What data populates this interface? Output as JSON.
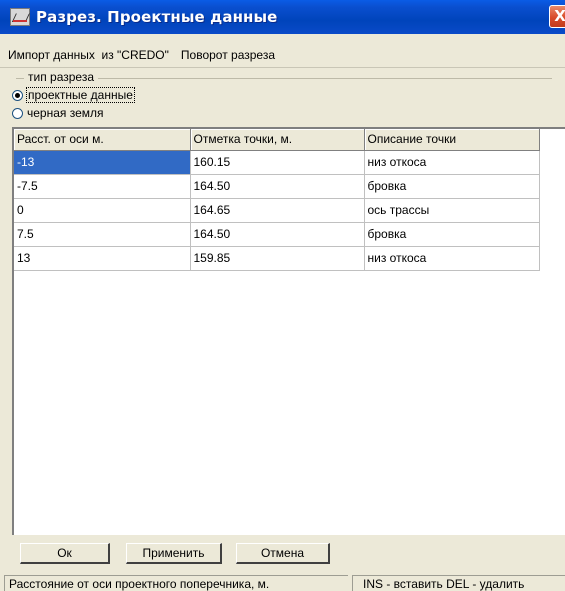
{
  "window": {
    "title": "Разрез. Проектные данные",
    "close_label": "X"
  },
  "menu": {
    "items": [
      {
        "label": "Импорт данных  из \"CREDO\""
      },
      {
        "label": "Поворот разреза"
      }
    ]
  },
  "section_type": {
    "legend": "тип разреза",
    "options": [
      {
        "label": "проектные данные",
        "checked": true
      },
      {
        "label": "черная земля",
        "checked": false
      }
    ]
  },
  "table": {
    "columns": [
      "Расст. от оси  м.",
      "Отметка точки, м.",
      "Описание точки"
    ],
    "rows": [
      [
        "-13",
        "160.15",
        "низ откоса"
      ],
      [
        "-7.5",
        "164.50",
        "бровка"
      ],
      [
        "0",
        "164.65",
        "ось трассы"
      ],
      [
        "7.5",
        "164.50",
        "бровка"
      ],
      [
        "13",
        "159.85",
        "низ откоса"
      ]
    ],
    "selected_cell": {
      "row": 0,
      "col": 0
    }
  },
  "buttons": {
    "ok": "Ок",
    "apply": "Применить",
    "cancel": "Отмена"
  },
  "status": {
    "left": "Расстояние от оси проектного поперечника, м.",
    "right": "INS - вставить DEL - удалить"
  },
  "colors": {
    "selection": "#316ac5",
    "titlebar": "#0044bb",
    "face": "#ece9d8"
  }
}
